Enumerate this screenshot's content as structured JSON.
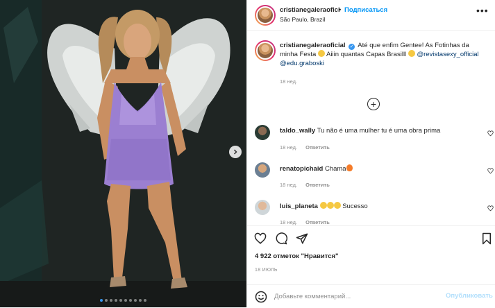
{
  "post": {
    "header": {
      "username": "cristianegaleraofici",
      "separator": "•",
      "follow_label": "Подписаться",
      "location": "São Paulo, Brazil",
      "more_icon": "more-horizontal-icon"
    },
    "caption": {
      "username": "cristianegaleraoficial",
      "text_1": "Até que enfim Gentee! As Fotinhas da minha Festa",
      "text_2": "Aiiin quantas Capas Brasilll",
      "mention_1": "@revistasexy_official",
      "mention_2": "@edu.graboski",
      "time": "18 нед."
    },
    "load_more_icon": "plus-circle-icon",
    "comments": [
      {
        "username": "taldo_wally",
        "text": "Tu não é uma mulher tu é uma obra prima",
        "time": "18 нед.",
        "reply": "Ответить"
      },
      {
        "username": "renatopichaid",
        "text": "Chama",
        "time": "18 нед.",
        "reply": "Ответить"
      },
      {
        "username": "luis_planeta",
        "text": "Sucesso",
        "time": "18 нед.",
        "reply": "Ответить"
      }
    ],
    "likes_text": "4 922 отметок \"Нравится\"",
    "date": "18 ИЮЛЬ",
    "comment_input": {
      "placeholder": "Добавьте комментарий...",
      "value": ""
    },
    "publish_label": "Опубликовать",
    "carousel": {
      "total": 10,
      "active": 0
    },
    "colors": {
      "accent": "#0095f6",
      "verified": "#3897f0",
      "publish_disabled": "#b2dffc",
      "secondary": "#8e8e8e"
    }
  }
}
